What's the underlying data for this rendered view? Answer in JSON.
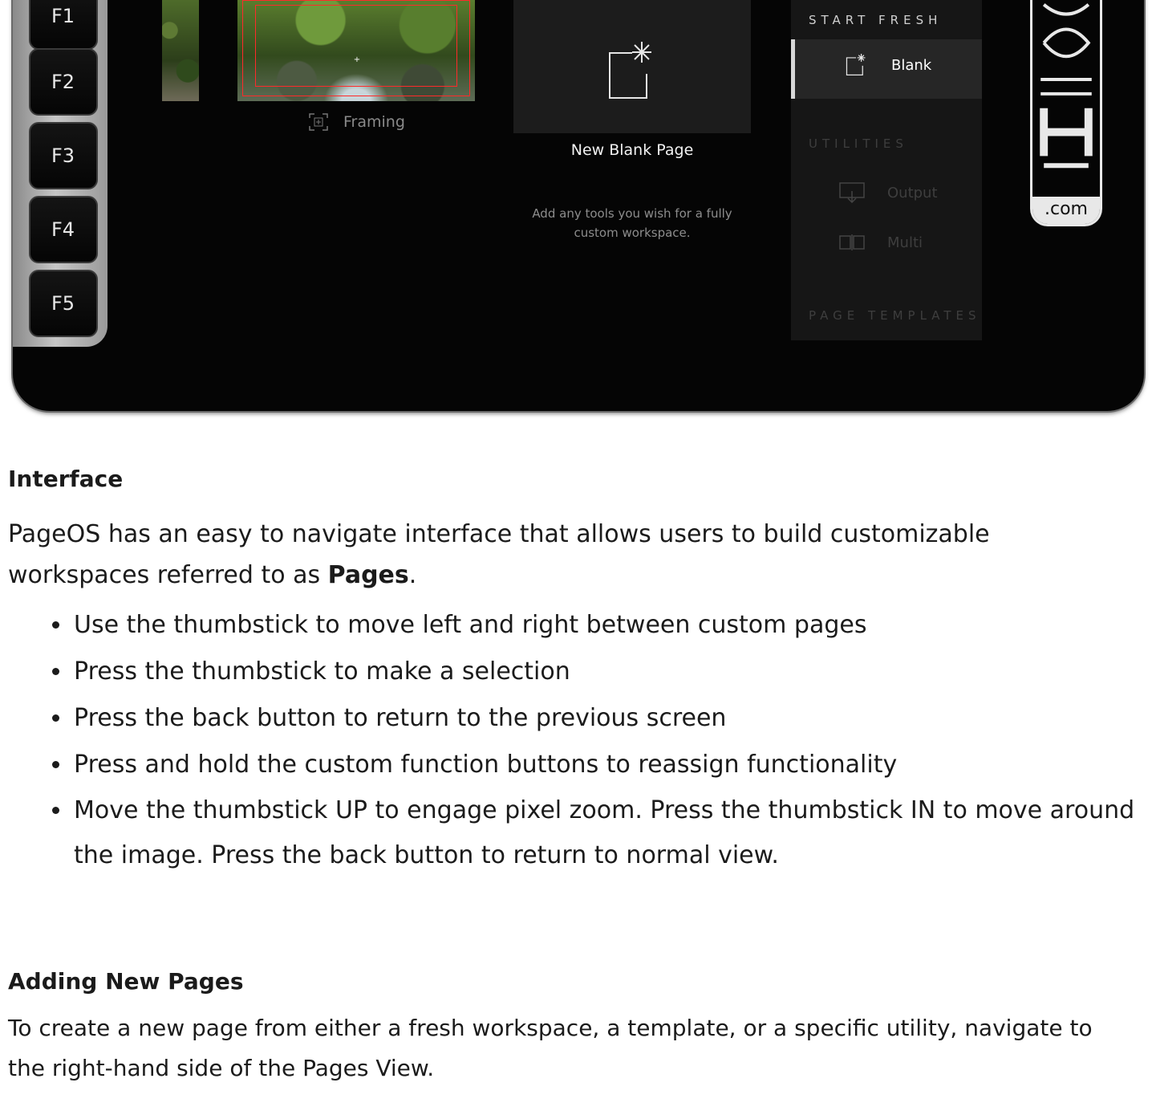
{
  "device": {
    "function_keys": [
      "F1",
      "F2",
      "F3",
      "F4",
      "F5"
    ],
    "framing_label": "Framing",
    "blank_card": {
      "title": "New Blank Page",
      "description_line1": "Add any tools you wish for a fully",
      "description_line2": "custom workspace."
    },
    "panel": {
      "start_fresh_label": "START FRESH",
      "blank_label": "Blank",
      "utilities_label": "UTILITIES",
      "output_label": "Output",
      "multi_label": "Multi",
      "page_templates_label": "PAGE TEMPLATES"
    },
    "brand_suffix": ".com"
  },
  "content": {
    "interface_heading": "Interface",
    "intro_prefix": "PageOS has an easy to navigate interface that allows users to build customizable workspaces referred to as ",
    "intro_bold": "Pages",
    "intro_suffix": ".",
    "bullets": [
      "Use the thumbstick to move left and right between custom pages",
      "Press the thumbstick to make a selection",
      "Press the back button to return to the previous screen",
      "Press and hold the custom function buttons to reassign functionality",
      "Move the thumbstick UP to engage pixel zoom. Press the thumbstick IN to move around the image. Press the back button to return to normal view."
    ],
    "adding_heading": "Adding New Pages",
    "adding_text": "To create a new page from either a fresh workspace, a template, or a specific utility, navigate to the right-hand side of the Pages View."
  },
  "colors": {
    "screen_bg": "#050505",
    "panel_bg": "#161616",
    "selected_bg": "#262626",
    "dim_text": "#3e3e3e",
    "frame_line": "#ff2a2a"
  }
}
